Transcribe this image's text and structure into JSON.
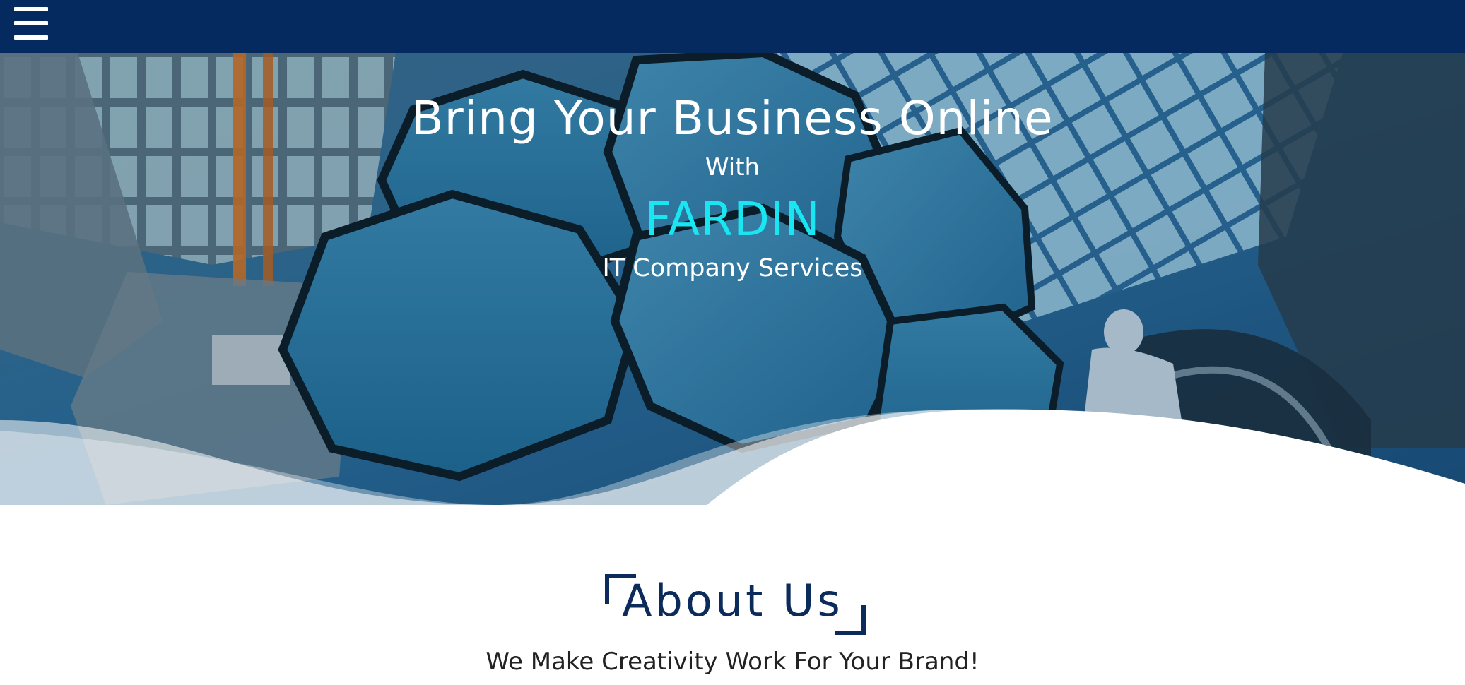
{
  "nav": {
    "menu_icon": "hamburger-menu-icon",
    "background_color": "#052a5f"
  },
  "hero": {
    "title": "Bring Your Business Online",
    "with": "With",
    "brand": "FARDIN",
    "services": "IT Company Services",
    "brand_color": "#19e6f0"
  },
  "about": {
    "heading": "About Us",
    "subheading": "We Make Creativity Work For Your Brand!",
    "heading_color": "#0b2b5b"
  }
}
